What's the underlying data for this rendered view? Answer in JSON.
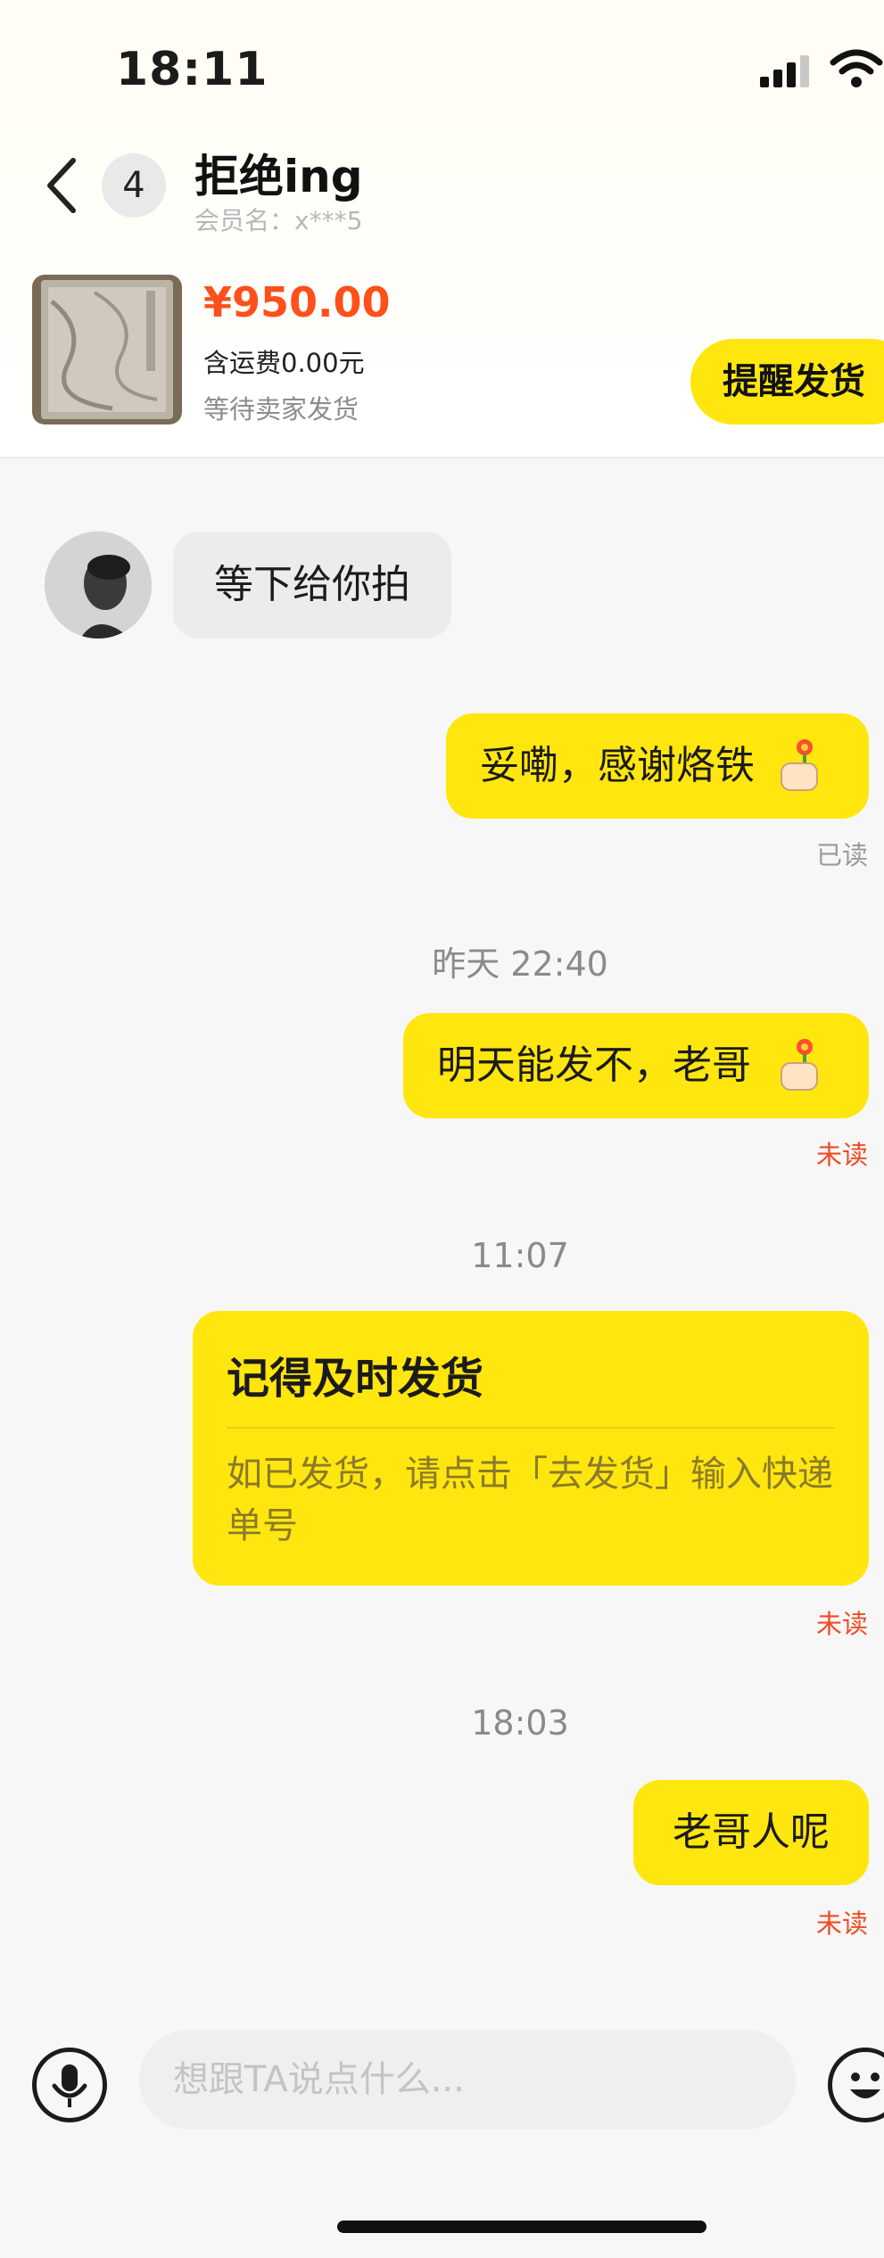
{
  "status_bar": {
    "time": "18:11"
  },
  "header": {
    "unread_count": "4",
    "nickname": "拒绝ing",
    "member_label": "会员名：x***5"
  },
  "order": {
    "price": "¥950.00",
    "shipping": "含运费0.00元",
    "status": "等待卖家发货",
    "remind_button": "提醒发货"
  },
  "messages": [
    {
      "direction": "in",
      "text": "等下给你拍"
    },
    {
      "direction": "out",
      "text": "妥嘞，感谢烙铁",
      "emoji": "thumbs-up-flower-icon",
      "read_status": "已读"
    },
    {
      "timestamp": "昨天 22:40"
    },
    {
      "direction": "out",
      "text": "明天能发不，老哥",
      "emoji": "thumbs-up-flower-icon",
      "read_status": "未读"
    },
    {
      "timestamp": "11:07"
    },
    {
      "direction": "out",
      "card": {
        "title": "记得及时发货",
        "body": "如已发货，请点击「去发货」输入快递单号"
      },
      "read_status": "未读"
    },
    {
      "timestamp": "18:03"
    },
    {
      "direction": "out",
      "text": "老哥人呢",
      "read_status": "未读"
    }
  ],
  "input": {
    "placeholder": "想跟TA说点什么..."
  },
  "colors": {
    "accent_yellow": "#ffe60f",
    "price_orange": "#ff4f1a",
    "unread_red": "#f04b24"
  }
}
